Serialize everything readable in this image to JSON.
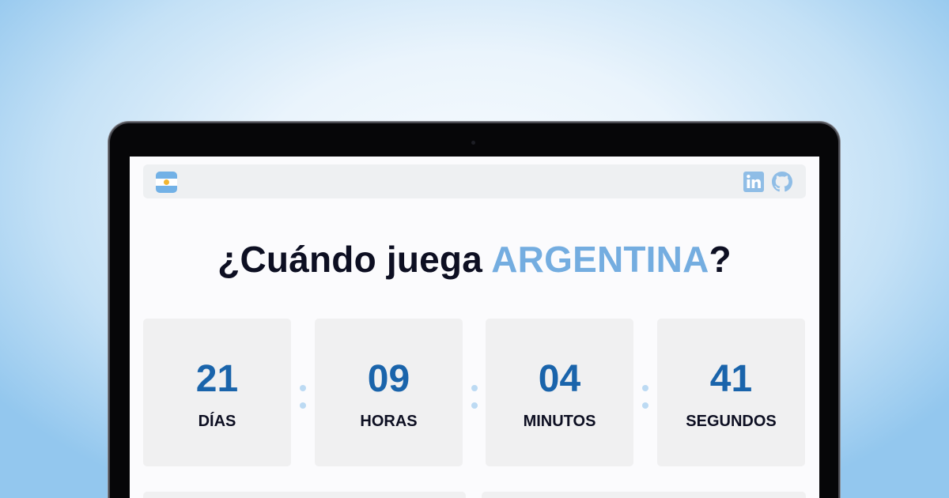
{
  "header": {
    "flag_icon": "argentina-flag-icon",
    "social_links": [
      {
        "icon": "linkedin-icon"
      },
      {
        "icon": "github-icon"
      }
    ]
  },
  "title": {
    "prefix": "¿Cuándo juega ",
    "highlight": "ARGENTINA",
    "suffix": "?"
  },
  "countdown": [
    {
      "value": "21",
      "label": "DÍAS"
    },
    {
      "value": "09",
      "label": "HORAS"
    },
    {
      "value": "04",
      "label": "MINUTOS"
    },
    {
      "value": "41",
      "label": "SEGUNDOS"
    }
  ],
  "colors": {
    "accent": "#74ade0",
    "number": "#1a64ab",
    "heading": "#0d0f22",
    "card_bg": "#f0f0f1"
  }
}
